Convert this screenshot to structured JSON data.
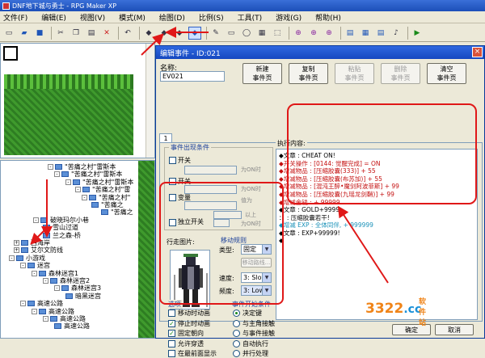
{
  "window": {
    "title": "DNF地下城与勇士 - RPG Maker XP"
  },
  "menu": [
    "文件(F)",
    "编辑(E)",
    "视图(V)",
    "模式(M)",
    "绘图(D)",
    "比例(S)",
    "工具(T)",
    "游戏(G)",
    "帮助(H)"
  ],
  "tree": {
    "nodes": [
      {
        "label": "\"苦痛之村\"雷斯本",
        "expander": "-"
      },
      {
        "label": "\"苦痛之村\"雷斯本",
        "expander": "-"
      },
      {
        "label": "\"苦痛之村\"雷斯本",
        "expander": "-"
      },
      {
        "label": "\"苦痛之村\"雷",
        "expander": "-"
      },
      {
        "label": "\"苦痛之村\"",
        "expander": "-"
      },
      {
        "label": "\"苦痛之",
        "expander": ""
      },
      {
        "label": "\"苦痛之",
        "expander": ""
      },
      {
        "label": "破晓玛尔小巷",
        "expander": "-"
      },
      {
        "label": "雪山过道",
        "expander": ""
      },
      {
        "label": "兰之森-桥",
        "expander": ""
      },
      {
        "label": "西海岸",
        "expander": "+"
      },
      {
        "label": "艾尔文防线",
        "expander": "+"
      },
      {
        "label": "小游戏",
        "expander": "-"
      },
      {
        "label": "迷宫",
        "expander": "-"
      },
      {
        "label": "森林迷宫1",
        "expander": "-"
      },
      {
        "label": "森林迷宫2",
        "expander": "-"
      },
      {
        "label": "森林迷宫3",
        "expander": "-"
      },
      {
        "label": "暗黑迷宫",
        "expander": ""
      },
      {
        "label": "高速公路",
        "expander": "-"
      },
      {
        "label": "高速公路",
        "expander": "-"
      },
      {
        "label": "高速公路",
        "expander": "-"
      },
      {
        "label": "高速公路",
        "expander": ""
      }
    ]
  },
  "dialog": {
    "title": "编辑事件 - ID:021",
    "close": "×",
    "name_label": "名称:",
    "name_value": "EV021",
    "buttons": {
      "new_page": [
        "新建",
        "事件页"
      ],
      "copy_page": [
        "复制",
        "事件页"
      ],
      "paste_page": [
        "粘贴",
        "事件页"
      ],
      "delete_page": [
        "删除",
        "事件页"
      ],
      "clear_page": [
        "清空",
        "事件页"
      ]
    },
    "tab": "1",
    "conditions": {
      "title": "事件出现条件",
      "switch1": "开关",
      "switch2": "开关",
      "switch_suffix": "为ON时",
      "variable": "变量",
      "variable_suffix": "值为",
      "variable_above": "以上",
      "self_switch": "独立开关",
      "self_switch_suffix": "为ON时"
    },
    "graphic": {
      "title": "行走图片:"
    },
    "movement": {
      "title": "移动规则",
      "type_label": "类型:",
      "type_value": "固定",
      "route_button": "移动路线...",
      "speed_label": "速度:",
      "speed_value": "3: Slow",
      "freq_label": "频度:",
      "freq_value": "3: Low"
    },
    "options": {
      "title": "选项",
      "items": [
        {
          "label": "移动时动画",
          "checked": false
        },
        {
          "label": "停止时动画",
          "checked": true
        },
        {
          "label": "固定朝向",
          "checked": true
        },
        {
          "label": "允许穿透",
          "checked": false
        },
        {
          "label": "在最前面显示",
          "checked": false
        }
      ]
    },
    "trigger": {
      "title": "事件开始条件",
      "items": [
        {
          "label": "决定键",
          "selected": true
        },
        {
          "label": "与主角接触",
          "selected": false
        },
        {
          "label": "与事件接触",
          "selected": false
        },
        {
          "label": "自动执行",
          "selected": false
        },
        {
          "label": "并行处理",
          "selected": false
        }
      ]
    },
    "commands": {
      "title": "执行内容:",
      "lines": [
        {
          "text": "◆文章 : CHEAT ON!",
          "style": "black"
        },
        {
          "text": "◆开关操作 : [0144: 觉醒完成] = ON",
          "style": "red"
        },
        {
          "text": "◆增减物品 : [压缩胶囊(333)] + 55",
          "style": "red"
        },
        {
          "text": "◆增减物品 : [压缩胶囊(布苏加)] + 55",
          "style": "red"
        },
        {
          "text": "◆增减物品 : [混沌王醉•魔剑阿波菲斯] + 99",
          "style": "red"
        },
        {
          "text": "◆增减物品 : [压缩胶囊(九瑶龙剑鞘)] + 99",
          "style": "red"
        },
        {
          "text": "◆增减金钱 : + 99999",
          "style": "red"
        },
        {
          "text": "◆文章 : GOLD+9999",
          "style": "black"
        },
        {
          "text": "：        : 压缩胶囊若干!",
          "style": "black"
        },
        {
          "text": "◆增减 EXP : 全体同伴, + 999999",
          "style": "cyan"
        },
        {
          "text": "◆文章 : EXP+99999!",
          "style": "black"
        },
        {
          "text": "◆",
          "style": "black"
        }
      ]
    },
    "footer": {
      "ok": "确定",
      "cancel": "取消"
    }
  },
  "watermark": {
    "number": "3322",
    "tld": ".cc",
    "site": "软件站"
  }
}
